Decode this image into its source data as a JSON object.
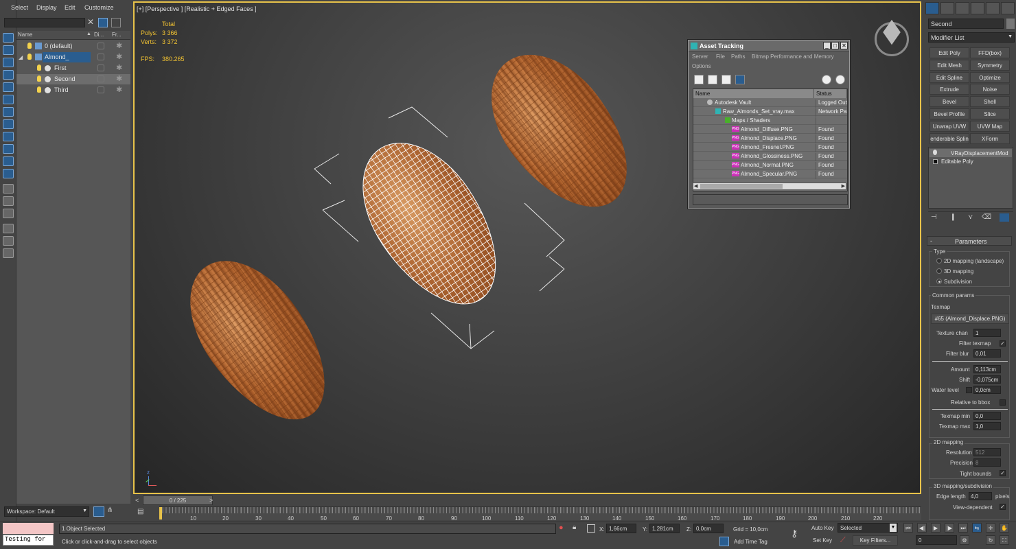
{
  "explorer": {
    "menu": [
      "Select",
      "Display",
      "Edit",
      "Customize"
    ],
    "columns": {
      "name": "Name",
      "display": "Di...",
      "freeze": "Fr..."
    },
    "layers": [
      {
        "label": "0 (default)"
      },
      {
        "label": "Almond_"
      },
      {
        "label": "First"
      },
      {
        "label": "Second"
      },
      {
        "label": "Third"
      }
    ],
    "workspace": "Workspace: Default"
  },
  "viewport": {
    "label": "[+] [Perspective ] [Realistic + Edged Faces ]",
    "stats": {
      "total_label": "Total",
      "polys_label": "Polys:",
      "polys": "3 366",
      "verts_label": "Verts:",
      "verts": "3 372",
      "fps_label": "FPS:",
      "fps": "380.265"
    },
    "axis": {
      "x": "x",
      "y": "y",
      "z": "z"
    }
  },
  "asset_tracking": {
    "title": "Asset Tracking",
    "menu": [
      "Server",
      "File",
      "Paths",
      "Bitmap Performance and Memory",
      "Options"
    ],
    "columns": {
      "name": "Name",
      "status": "Status"
    },
    "rows": [
      {
        "name": "Autodesk Vault",
        "status": "Logged Out"
      },
      {
        "name": "Raw_Almonds_Set_vray.max",
        "status": "Network Path"
      },
      {
        "name": "Maps / Shaders",
        "status": ""
      },
      {
        "name": "Almond_Diffuse.PNG",
        "status": "Found"
      },
      {
        "name": "Almond_Displace.PNG",
        "status": "Found"
      },
      {
        "name": "Almond_Fresnel.PNG",
        "status": "Found"
      },
      {
        "name": "Almond_Glossiness.PNG",
        "status": "Found"
      },
      {
        "name": "Almond_Normal.PNG",
        "status": "Found"
      },
      {
        "name": "Almond_Specular.PNG",
        "status": "Found"
      }
    ],
    "png_tag": "PNG"
  },
  "command_panel": {
    "object_name": "Second",
    "modifier_list": "Modifier List",
    "modifier_buttons": [
      "Edit Poly",
      "FFD(box)",
      "Edit Mesh",
      "Symmetry",
      "Edit Spline",
      "Optimize",
      "Extrude",
      "Noise",
      "Bevel",
      "Shell",
      "Bevel Profile",
      "Slice",
      "Unwrap UVW",
      "UVW Map",
      "enderable Splin",
      "XForm"
    ],
    "stack": [
      "VRayDisplacementMod",
      "Editable Poly"
    ],
    "parameters": {
      "title": "Parameters",
      "type_label": "Type",
      "type_options": [
        "2D mapping (landscape)",
        "3D mapping",
        "Subdivision"
      ],
      "common_label": "Common params",
      "texmap_label": "Texmap",
      "texmap_value": "#65 (Almond_Displace.PNG)",
      "texture_chan_label": "Texture chan",
      "texture_chan": "1",
      "filter_texmap_label": "Filter texmap",
      "filter_blur_label": "Filter blur",
      "filter_blur": "0,01",
      "amount_label": "Amount",
      "amount": "0,113cm",
      "shift_label": "Shift",
      "shift": "-0,075cm",
      "water_level_label": "Water level",
      "water_level": "0,0cm",
      "relative_label": "Relative to bbox",
      "texmap_min_label": "Texmap min",
      "texmap_min": "0,0",
      "texmap_max_label": "Texmap max",
      "texmap_max": "1,0",
      "mapping2d_label": "2D mapping",
      "resolution_label": "Resolution",
      "resolution": "512",
      "precision_label": "Precision",
      "precision": "8",
      "tight_bounds_label": "Tight bounds",
      "mapping3d_label": "3D mapping/subdivision",
      "edge_length_label": "Edge length",
      "edge_length": "4,0",
      "pixels_label": "pixels",
      "view_dependent_label": "View-dependent",
      "check": "✓"
    }
  },
  "timeline": {
    "frame": "0 / 225",
    "ticks": [
      "10",
      "20",
      "30",
      "40",
      "50",
      "60",
      "70",
      "80",
      "90",
      "100",
      "110",
      "120",
      "130",
      "140",
      "150",
      "160",
      "170",
      "180",
      "190",
      "200",
      "210",
      "220"
    ]
  },
  "status": {
    "script_input": "Testing for",
    "selection": "1 Object Selected",
    "prompt": "Click or click-and-drag to select objects",
    "x_label": "X:",
    "x": "1,66cm",
    "y_label": "Y:",
    "y": "1,281cm",
    "z_label": "Z:",
    "z": "0,0cm",
    "grid": "Grid = 10,0cm",
    "add_time_tag": "Add Time Tag",
    "auto_key": "Auto Key",
    "set_key": "Set Key",
    "key_selected": "Selected",
    "key_filters": "Key Filters...",
    "frame_field": "0"
  },
  "colors": {
    "viewport_border": "#e8c34a",
    "accent": "#2a5d8f",
    "stats": "#f1c232"
  }
}
